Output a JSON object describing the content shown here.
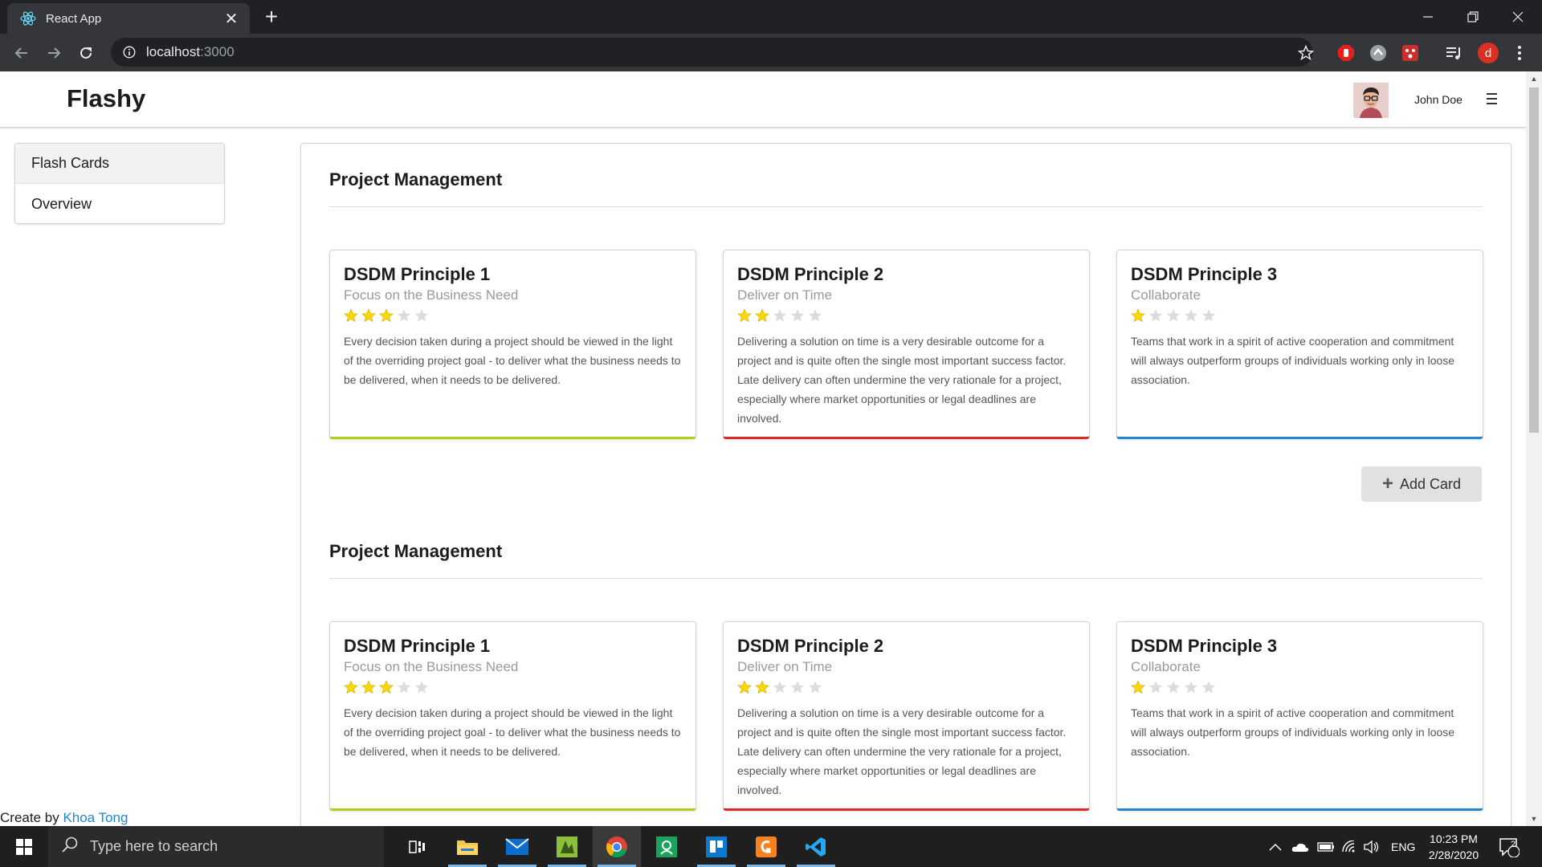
{
  "browser": {
    "tab_title": "React App",
    "url_host": "localhost",
    "url_port": ":3000",
    "profile_initial": "d"
  },
  "app": {
    "brand": "Flashy",
    "user_name": "John Doe"
  },
  "sidebar": {
    "items": [
      {
        "label": "Flash Cards",
        "active": true
      },
      {
        "label": "Overview",
        "active": false
      }
    ]
  },
  "sections": [
    {
      "title": "Project Management",
      "cards": [
        {
          "title": "DSDM Principle 1",
          "meta": "Focus on the Business Need",
          "rating": 3,
          "rating_max": 5,
          "color": "#b5cc18",
          "description": "Every decision taken during a project should be viewed in the light of the overriding project goal - to deliver what the business needs to be delivered, when it needs to be delivered."
        },
        {
          "title": "DSDM Principle 2",
          "meta": "Deliver on Time",
          "rating": 2,
          "rating_max": 5,
          "color": "#db2828",
          "description": "Delivering a solution on time is a very desirable outcome for a project and is quite often the single most important success factor. Late delivery can often undermine the very rationale for a project, especially where market opportunities or legal deadlines are involved."
        },
        {
          "title": "DSDM Principle 3",
          "meta": "Collaborate",
          "rating": 1,
          "rating_max": 5,
          "color": "#2185d0",
          "description": "Teams that work in a spirit of active cooperation and commitment will always outperform groups of individuals working only in loose association."
        }
      ],
      "add_button": "Add Card"
    },
    {
      "title": "Project Management",
      "cards": [
        {
          "title": "DSDM Principle 1",
          "meta": "Focus on the Business Need",
          "rating": 3,
          "rating_max": 5,
          "color": "#b5cc18",
          "description": "Every decision taken during a project should be viewed in the light of the overriding project goal - to deliver what the business needs to be delivered, when it needs to be delivered."
        },
        {
          "title": "DSDM Principle 2",
          "meta": "Deliver on Time",
          "rating": 2,
          "rating_max": 5,
          "color": "#db2828",
          "description": "Delivering a solution on time is a very desirable outcome for a project and is quite often the single most important success factor. Late delivery can often undermine the very rationale for a project, especially where market opportunities or legal deadlines are involved."
        },
        {
          "title": "DSDM Principle 3",
          "meta": "Collaborate",
          "rating": 1,
          "rating_max": 5,
          "color": "#2185d0",
          "description": "Teams that work in a spirit of active cooperation and commitment will always outperform groups of individuals working only in loose association."
        }
      ]
    }
  ],
  "footer": {
    "prefix": "Create by ",
    "author": "Khoa Tong"
  },
  "taskbar": {
    "search_placeholder": "Type here to search",
    "language": "ENG",
    "time": "10:23 PM",
    "date": "2/28/2020",
    "notification_count": "2",
    "apps": [
      "task-view",
      "file-explorer",
      "mail",
      "git-tool",
      "chrome",
      "contacts",
      "trello",
      "sublime",
      "vscode"
    ]
  },
  "colors": {
    "star_active": "#ffd700",
    "star_inactive": "#dcdcdc",
    "link": "#2185d0"
  }
}
